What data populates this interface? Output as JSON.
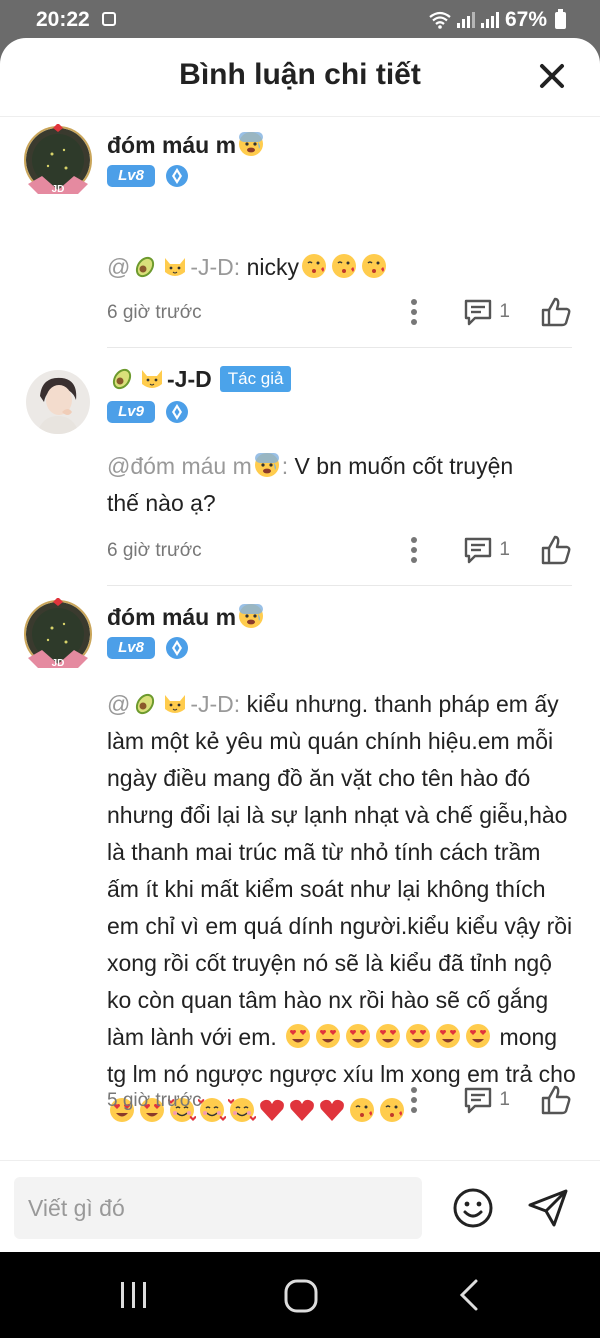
{
  "status_bar": {
    "time": "20:22",
    "battery": "67%"
  },
  "header": {
    "title": "Bình luận chi tiết"
  },
  "comments": [
    {
      "username": "đóm máu m",
      "username_emoji": "anxious-face",
      "level": "Lv8",
      "author_badge": "",
      "mention": "@",
      "mention_suffix": "-J-D:",
      "mention_emojis": [
        "avocado",
        "cat-face"
      ],
      "text": " nicky",
      "text_emojis": [
        "kissing-heart",
        "kissing-heart",
        "kissing-heart"
      ],
      "time": "6 giờ trước",
      "reply_count": "1"
    },
    {
      "username": "-J-D",
      "username_prefix_emojis": [
        "avocado",
        "cat-face"
      ],
      "level": "Lv9",
      "author_badge": "Tác giả",
      "mention": "@đóm máu m",
      "mention_suffix": ":",
      "mention_emojis": [
        "anxious-face"
      ],
      "text_line1": " V bn muốn cốt truyện",
      "text_line2": "thế nào ạ?",
      "time": "6 giờ trước",
      "reply_count": "1"
    },
    {
      "username": "đóm máu m",
      "username_emoji": "anxious-face",
      "level": "Lv8",
      "author_badge": "",
      "mention": "@",
      "mention_suffix": "-J-D:",
      "mention_emojis": [
        "avocado",
        "cat-face"
      ],
      "text_part1": " kiểu nhưng. thanh pháp em ấy làm một kẻ yêu mù quán chính hiệu.em mỗi ngày điều mang đồ ăn vặt cho tên hào đó nhưng đổi lại là sự lạnh nhạt và chế giễu,hào là thanh mai trúc mã từ nhỏ tính cách trầm ấm ít khi mất kiểm soát như lại không thích em chỉ vì em quá dính người.kiểu kiểu vậy rồi xong rồi cốt truyện nó sẽ là kiểu đã tỉnh ngộ ko còn quan tâm hào nx rồi hào sẽ cố gắng làm lành với em.",
      "text_part2": " mong tg lm nó ngược ngược xíu lm xong em trả cho",
      "emoji_run1": [
        "heart-eyes",
        "heart-eyes",
        "heart-eyes",
        "heart-eyes",
        "heart-eyes",
        "heart-eyes",
        "heart-eyes"
      ],
      "emoji_run2": [
        "heart-eyes",
        "heart-eyes",
        "smiling-hearts",
        "smiling-hearts",
        "smiling-hearts",
        "red-heart",
        "red-heart",
        "red-heart",
        "kissing-heart",
        "kissing-heart"
      ],
      "time": "5 giờ trước",
      "reply_count": "1"
    }
  ],
  "input": {
    "placeholder": "Viết gì đó"
  },
  "colors": {
    "accent": "#4ba3ea",
    "level_badge": "#4c9fe8",
    "mention": "#999999",
    "meta": "#777777"
  }
}
